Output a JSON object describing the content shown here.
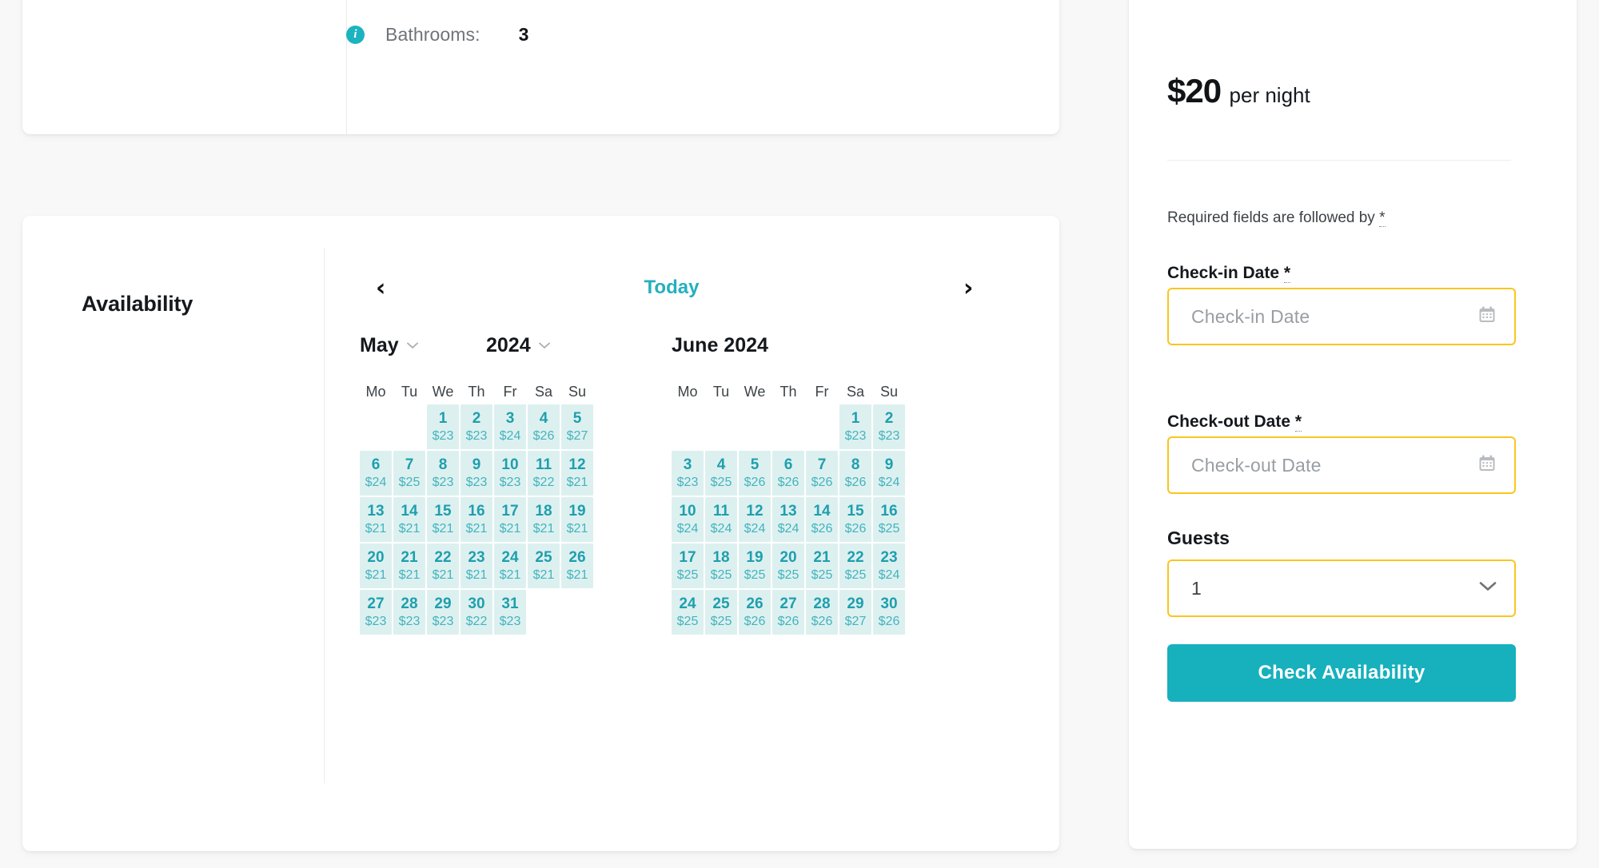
{
  "details": {
    "info_icon": "info-icon",
    "rows": [
      {
        "label": "Bathrooms:",
        "value": "3"
      }
    ]
  },
  "availability": {
    "title": "Availability",
    "calendar": {
      "prev_label": "‹",
      "next_label": "›",
      "today_label": "Today",
      "weekdays": [
        "Mo",
        "Tu",
        "We",
        "Th",
        "Fr",
        "Sa",
        "Su"
      ],
      "month_select": "May",
      "year_select": "2024",
      "second_month_title": "June 2024",
      "chevron": "⌄",
      "months": [
        {
          "name": "May",
          "year": "2024",
          "lead_blanks": 2,
          "days": [
            {
              "day": "1",
              "price": "$23"
            },
            {
              "day": "2",
              "price": "$23"
            },
            {
              "day": "3",
              "price": "$24"
            },
            {
              "day": "4",
              "price": "$26"
            },
            {
              "day": "5",
              "price": "$27"
            },
            {
              "day": "6",
              "price": "$24"
            },
            {
              "day": "7",
              "price": "$25"
            },
            {
              "day": "8",
              "price": "$23"
            },
            {
              "day": "9",
              "price": "$23"
            },
            {
              "day": "10",
              "price": "$23"
            },
            {
              "day": "11",
              "price": "$22"
            },
            {
              "day": "12",
              "price": "$21"
            },
            {
              "day": "13",
              "price": "$21"
            },
            {
              "day": "14",
              "price": "$21"
            },
            {
              "day": "15",
              "price": "$21"
            },
            {
              "day": "16",
              "price": "$21"
            },
            {
              "day": "17",
              "price": "$21"
            },
            {
              "day": "18",
              "price": "$21"
            },
            {
              "day": "19",
              "price": "$21"
            },
            {
              "day": "20",
              "price": "$21"
            },
            {
              "day": "21",
              "price": "$21"
            },
            {
              "day": "22",
              "price": "$21"
            },
            {
              "day": "23",
              "price": "$21"
            },
            {
              "day": "24",
              "price": "$21"
            },
            {
              "day": "25",
              "price": "$21"
            },
            {
              "day": "26",
              "price": "$21"
            },
            {
              "day": "27",
              "price": "$23"
            },
            {
              "day": "28",
              "price": "$23"
            },
            {
              "day": "29",
              "price": "$23"
            },
            {
              "day": "30",
              "price": "$22"
            },
            {
              "day": "31",
              "price": "$23"
            }
          ]
        },
        {
          "name": "June",
          "year": "2024",
          "lead_blanks": 5,
          "days": [
            {
              "day": "1",
              "price": "$23"
            },
            {
              "day": "2",
              "price": "$23"
            },
            {
              "day": "3",
              "price": "$23"
            },
            {
              "day": "4",
              "price": "$25"
            },
            {
              "day": "5",
              "price": "$26"
            },
            {
              "day": "6",
              "price": "$26"
            },
            {
              "day": "7",
              "price": "$26"
            },
            {
              "day": "8",
              "price": "$26"
            },
            {
              "day": "9",
              "price": "$24"
            },
            {
              "day": "10",
              "price": "$24"
            },
            {
              "day": "11",
              "price": "$24"
            },
            {
              "day": "12",
              "price": "$24"
            },
            {
              "day": "13",
              "price": "$24"
            },
            {
              "day": "14",
              "price": "$26"
            },
            {
              "day": "15",
              "price": "$26"
            },
            {
              "day": "16",
              "price": "$25"
            },
            {
              "day": "17",
              "price": "$25"
            },
            {
              "day": "18",
              "price": "$25"
            },
            {
              "day": "19",
              "price": "$25"
            },
            {
              "day": "20",
              "price": "$25"
            },
            {
              "day": "21",
              "price": "$25"
            },
            {
              "day": "22",
              "price": "$25"
            },
            {
              "day": "23",
              "price": "$24"
            },
            {
              "day": "24",
              "price": "$25"
            },
            {
              "day": "25",
              "price": "$25"
            },
            {
              "day": "26",
              "price": "$26"
            },
            {
              "day": "27",
              "price": "$26"
            },
            {
              "day": "28",
              "price": "$26"
            },
            {
              "day": "29",
              "price": "$27"
            },
            {
              "day": "30",
              "price": "$26"
            }
          ]
        }
      ]
    }
  },
  "booking": {
    "price_amount": "$20",
    "price_unit": "per night",
    "required_note_text": "Required fields are followed by",
    "required_star": "*",
    "checkin": {
      "label": "Check-in Date",
      "required_mark": "*",
      "placeholder": "Check-in Date",
      "value": "",
      "icon": "calendar-icon"
    },
    "checkout": {
      "label": "Check-out Date",
      "required_mark": "*",
      "placeholder": "Check-out Date",
      "value": "",
      "icon": "calendar-icon"
    },
    "guests": {
      "label": "Guests",
      "value": "1",
      "icon": "chevron-down-icon"
    },
    "submit_label": "Check Availability"
  },
  "colors": {
    "page_background": "#f8f8f8",
    "card_background": "#ffffff",
    "teal_accent": "#17b0bd",
    "teal_text": "#1e9fae",
    "cell_background": "#ddf0f0",
    "field_border_yellow": "#fbc51f",
    "info_icon_background": "#1cb3c0"
  }
}
